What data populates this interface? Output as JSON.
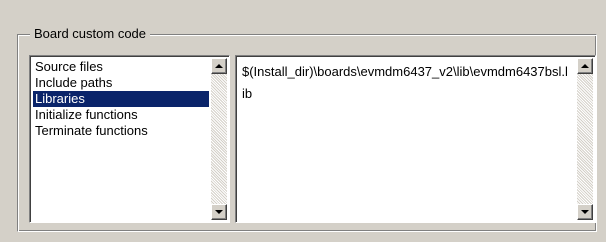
{
  "group": {
    "title": "Board custom code"
  },
  "categories": {
    "items": [
      {
        "label": "Source files"
      },
      {
        "label": "Include paths"
      },
      {
        "label": "Libraries"
      },
      {
        "label": "Initialize functions"
      },
      {
        "label": "Terminate functions"
      }
    ],
    "selected_index": 2
  },
  "code_entry": {
    "text": "$(Install_dir)\\boards\\evmdm6437_v2\\lib\\evmdm6437bsl.lib"
  },
  "icons": {
    "scroll_up": "triangle-up-icon",
    "scroll_down": "triangle-down-icon"
  },
  "colors": {
    "selection_bg": "#0a246a",
    "selection_fg": "#ffffff",
    "window_bg": "#d4d0c8"
  }
}
